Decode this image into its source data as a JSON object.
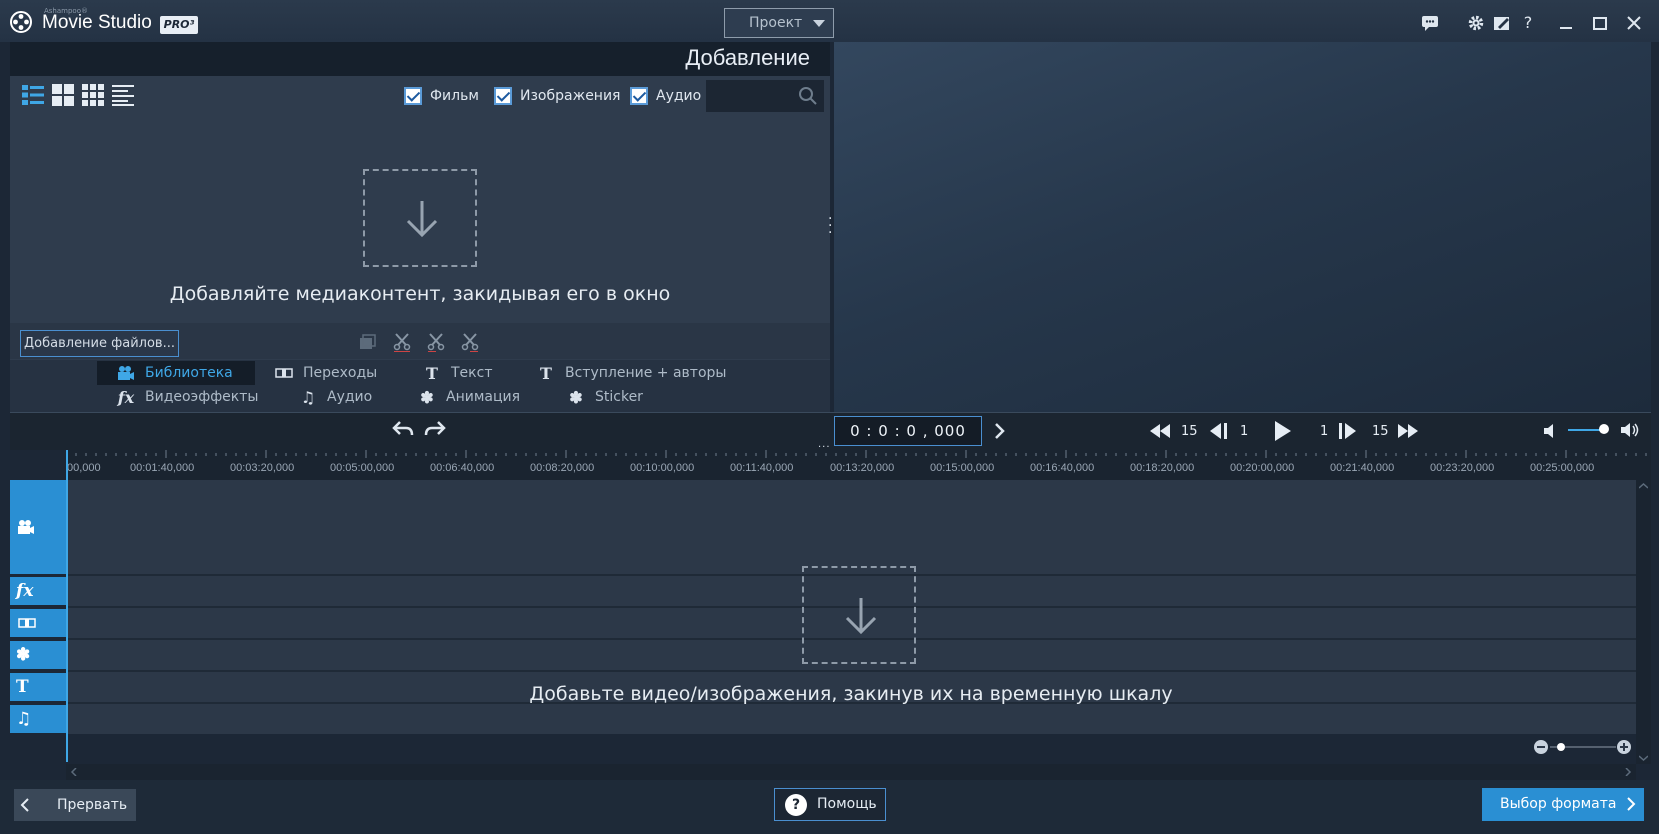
{
  "app": {
    "brand_small": "Ashampoo®",
    "title": "Movie Studio",
    "badge": "PRO³",
    "project_dropdown": "Проект"
  },
  "window_icons": [
    "feedback-icon",
    "settings-icon",
    "edit-icon",
    "help-icon",
    "minimize-icon",
    "maximize-icon",
    "close-icon"
  ],
  "window_help_glyph": "?",
  "media_panel": {
    "title": "Добавление",
    "filters": [
      {
        "label": "Фильм",
        "checked": true
      },
      {
        "label": "Изображения",
        "checked": true
      },
      {
        "label": "Аудио",
        "checked": true
      }
    ],
    "search_placeholder": "",
    "drop_text": "Добавляйте медиаконтент, закидывая его в окно",
    "add_files_button": "Добавление файлов..."
  },
  "tabs": [
    {
      "label": "Библиотека",
      "icon": "camera-icon",
      "active": true
    },
    {
      "label": "Переходы",
      "icon": "transition-icon",
      "active": false
    },
    {
      "label": "Текст",
      "icon": "text-icon",
      "active": false
    },
    {
      "label": "Вступление + авторы",
      "icon": "text-icon",
      "active": false
    },
    {
      "label": "Видеоэффекты",
      "icon": "fx-icon",
      "active": false
    },
    {
      "label": "Аудио",
      "icon": "music-icon",
      "active": false
    },
    {
      "label": "Анимация",
      "icon": "animation-icon",
      "active": false
    },
    {
      "label": "Sticker",
      "icon": "animation-icon",
      "active": false
    }
  ],
  "transport": {
    "timecode": "0 : 0 : 0 , 000",
    "rewind_frames": "15",
    "step_back_frames": "1",
    "step_fwd_frames": "1",
    "fastfwd_frames": "15"
  },
  "timeline": {
    "ticks": [
      "00,000",
      "00:01:40,000",
      "00:03:20,000",
      "00:05:00,000",
      "00:06:40,000",
      "00:08:20,000",
      "00:10:00,000",
      "00:11:40,000",
      "00:13:20,000",
      "00:15:00,000",
      "00:16:40,000",
      "00:18:20,000",
      "00:20:00,000",
      "00:21:40,000",
      "00:23:20,000",
      "00:25:00,000"
    ],
    "drop_text": "Добавьте видео/изображения, закинув их на временную шкалу"
  },
  "bottom": {
    "back_button": "Прервать",
    "help_button": "Помощь",
    "format_button": "Выбор формата"
  },
  "colors": {
    "accent": "#2a8fd3",
    "active_tab": "#3fa7e6"
  }
}
